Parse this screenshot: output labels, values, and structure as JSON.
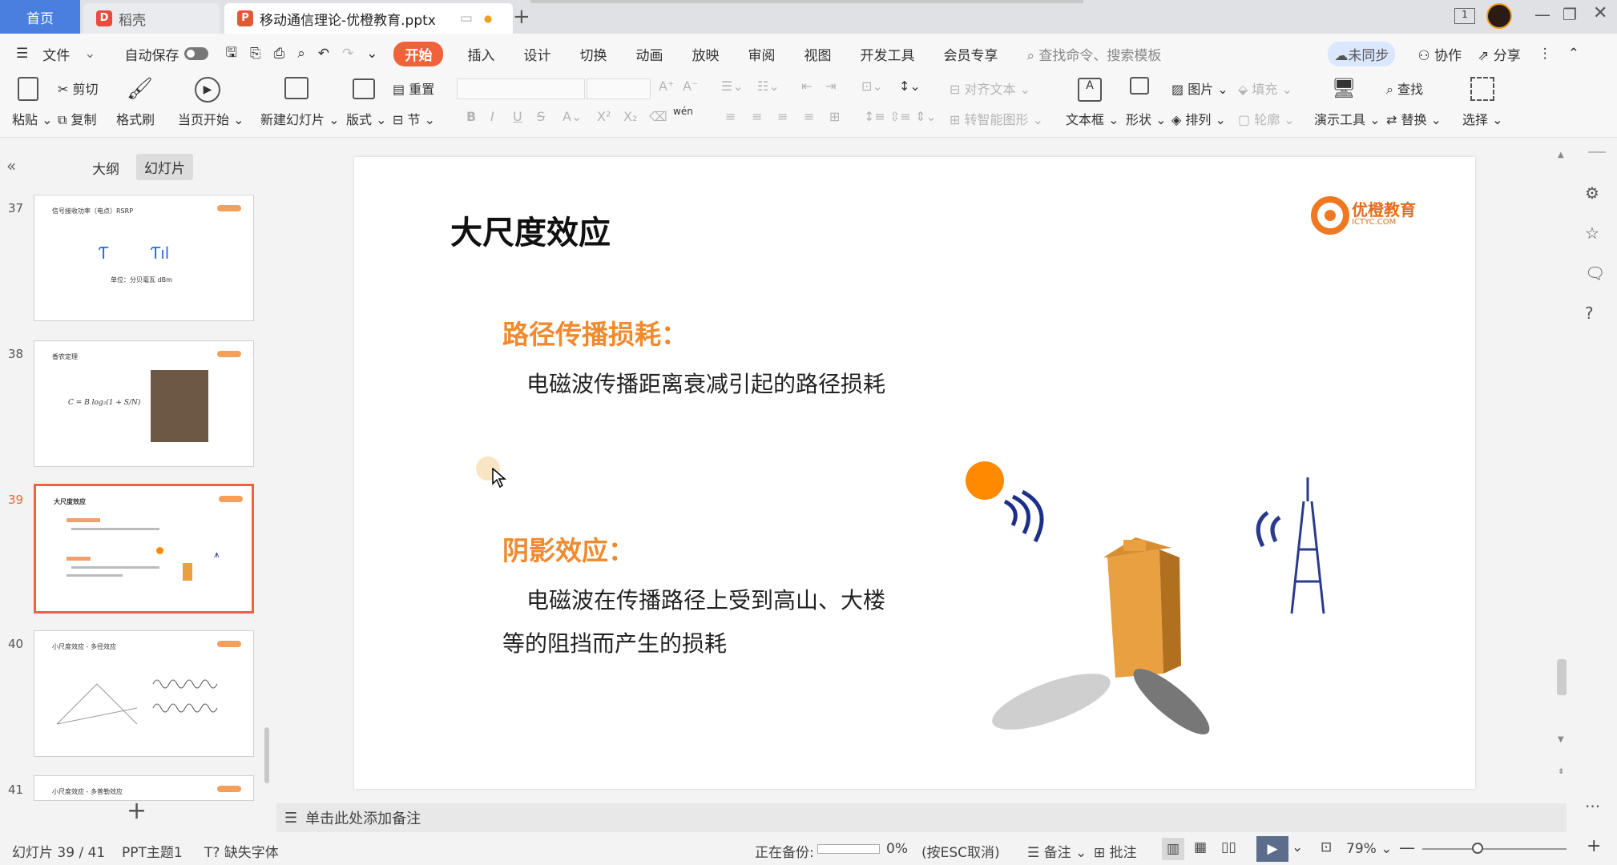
{
  "tabs": {
    "home": "首页",
    "daoke": "稻壳",
    "doc": "移动通信理论-优橙教育.pptx"
  },
  "menu": {
    "file": "文件",
    "autosave": "自动保存",
    "items": [
      "开始",
      "插入",
      "设计",
      "切换",
      "动画",
      "放映",
      "审阅",
      "视图",
      "开发工具",
      "会员专享"
    ],
    "search": "查找命令、搜索模板",
    "sync": "未同步",
    "collab": "协作",
    "share": "分享"
  },
  "ribbon": {
    "paste": "粘贴",
    "cut": "剪切",
    "copy": "复制",
    "format_painter": "格式刷",
    "from_current": "当页开始",
    "new_slide": "新建幻灯片",
    "layout": "版式",
    "reset": "重置",
    "section": "节",
    "align_text": "对齐文本",
    "smart_graphic": "转智能图形",
    "textbox": "文本框",
    "shape": "形状",
    "picture": "图片",
    "fill": "填充",
    "arrange": "排列",
    "outline": "轮廓",
    "present_tools": "演示工具",
    "find": "查找",
    "replace": "替换",
    "select": "选择",
    "font_size_up": "A⁺",
    "font_size_down": "A⁻",
    "pinyin": "wén"
  },
  "left": {
    "tab_outline": "大纲",
    "tab_slides": "幻灯片",
    "thumbs": [
      {
        "num": "37",
        "title": "信号接收功率（电点）RSRP",
        "caption": "单位：分贝毫瓦 dBm"
      },
      {
        "num": "38",
        "title": "香农定理",
        "formula": "C = B log₂(1 + S/N)"
      },
      {
        "num": "39",
        "title": "大尺度效应"
      },
      {
        "num": "40",
        "title": "小尺度效应 - 多径效应"
      },
      {
        "num": "41",
        "title": "小尺度效应 - 多普勒效应"
      }
    ]
  },
  "slide": {
    "title": "大尺度效应",
    "logo_text": "优橙教育",
    "logo_sub": "ICTYC.COM",
    "h1": "路径传播损耗：",
    "p1": "电磁波传播距离衰减引起的路径损耗",
    "h2": "阴影效应：",
    "p2a": "电磁波在传播路径上受到高山、大楼",
    "p2b": "等的阻挡而产生的损耗"
  },
  "notes": "单击此处添加备注",
  "status": {
    "slide_pos": "幻灯片 39 / 41",
    "theme": "PPT主题1",
    "missing_font": "缺失字体",
    "backup": "正在备份:",
    "backup_pct": "0%",
    "backup_hint": "(按ESC取消)",
    "notes_btn": "备注",
    "comment_btn": "批注",
    "zoom": "79%"
  },
  "colors": {
    "accent": "#f0623a",
    "slide_heading": "#f08a2e",
    "tab_home": "#4a7fe0"
  }
}
